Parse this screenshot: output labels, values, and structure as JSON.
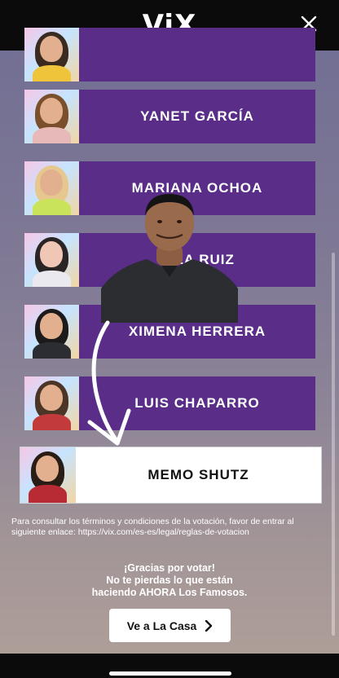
{
  "header": {
    "logo": "ViX"
  },
  "candidates": [
    {
      "name": "",
      "selected": false
    },
    {
      "name": "YANET GARCÍA",
      "selected": false
    },
    {
      "name": "MARIANA OCHOA",
      "selected": false
    },
    {
      "name": "A     ZA RUIZ",
      "selected": false
    },
    {
      "name": "XIMENA HERRERA",
      "selected": false
    },
    {
      "name": "LUIS CHAPARRO",
      "selected": false
    },
    {
      "name": "MEMO SHUTZ",
      "selected": true
    }
  ],
  "terms_text": "Para consultar los términos y condiciones de la votación, favor de entrar al siguiente enlace: https://vix.com/es-es/legal/reglas-de-votacion",
  "thanks": {
    "line1": "¡Gracias por votar!",
    "line2": "No te pierdas lo que están",
    "line3": "haciendo AHORA Los Famosos."
  },
  "cta": {
    "label": "Ve a La Casa"
  },
  "colors": {
    "accent": "#5a2d88",
    "selected_bg": "#ffffff",
    "header_bg": "#0b0b0c"
  }
}
